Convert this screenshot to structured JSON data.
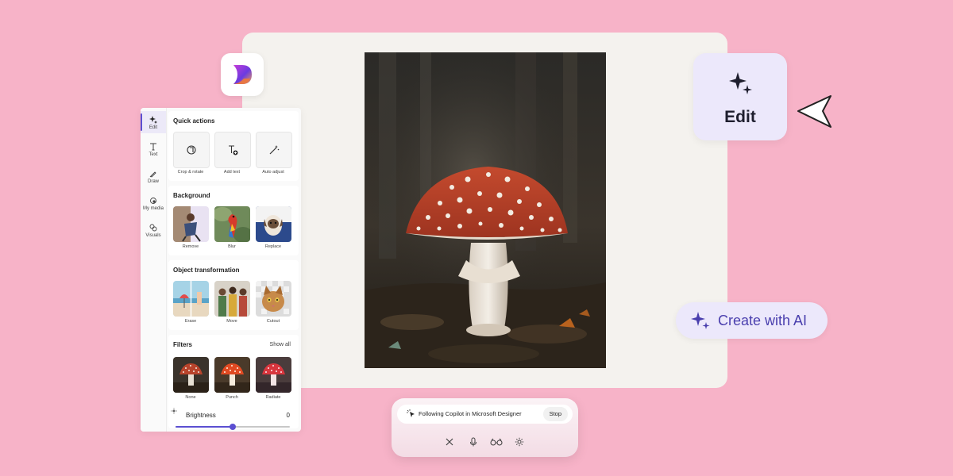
{
  "panel": {
    "rail": [
      {
        "label": "Edit",
        "icon": "sparkle-icon"
      },
      {
        "label": "Text",
        "icon": "text-icon"
      },
      {
        "label": "Draw",
        "icon": "pen-icon"
      },
      {
        "label": "My media",
        "icon": "media-icon"
      },
      {
        "label": "Visuals",
        "icon": "shapes-icon"
      }
    ],
    "quick_actions": {
      "title": "Quick actions",
      "items": [
        {
          "label": "Crop & rotate",
          "icon": "crop-rotate-icon"
        },
        {
          "label": "Add text",
          "icon": "add-text-icon"
        },
        {
          "label": "Auto adjust",
          "icon": "magic-wand-icon"
        }
      ]
    },
    "background": {
      "title": "Background",
      "items": [
        {
          "label": "Remove"
        },
        {
          "label": "Blur"
        },
        {
          "label": "Replace"
        }
      ]
    },
    "object_transformation": {
      "title": "Object transformation",
      "items": [
        {
          "label": "Erase"
        },
        {
          "label": "Move"
        },
        {
          "label": "Cutout"
        }
      ]
    },
    "filters": {
      "title": "Filters",
      "show_all": "Show all",
      "items": [
        {
          "label": "None"
        },
        {
          "label": "Punch"
        },
        {
          "label": "Radiate"
        }
      ]
    },
    "brightness": {
      "label": "Brightness",
      "value": "0",
      "level": 0.5
    }
  },
  "edit_callout": {
    "label": "Edit",
    "icon": "sparkle-icon"
  },
  "ai_pill": {
    "label": "Create with AI",
    "icon": "sparkle-icon"
  },
  "copilot_bar": {
    "status": "Following Copilot in Microsoft Designer",
    "stop_label": "Stop",
    "icons": [
      "close-icon",
      "microphone-icon",
      "glasses-icon",
      "settings-icon"
    ]
  },
  "colors": {
    "background": "#f7b3c8",
    "accent": "#5b4fd1",
    "callout": "#ece8fb"
  }
}
